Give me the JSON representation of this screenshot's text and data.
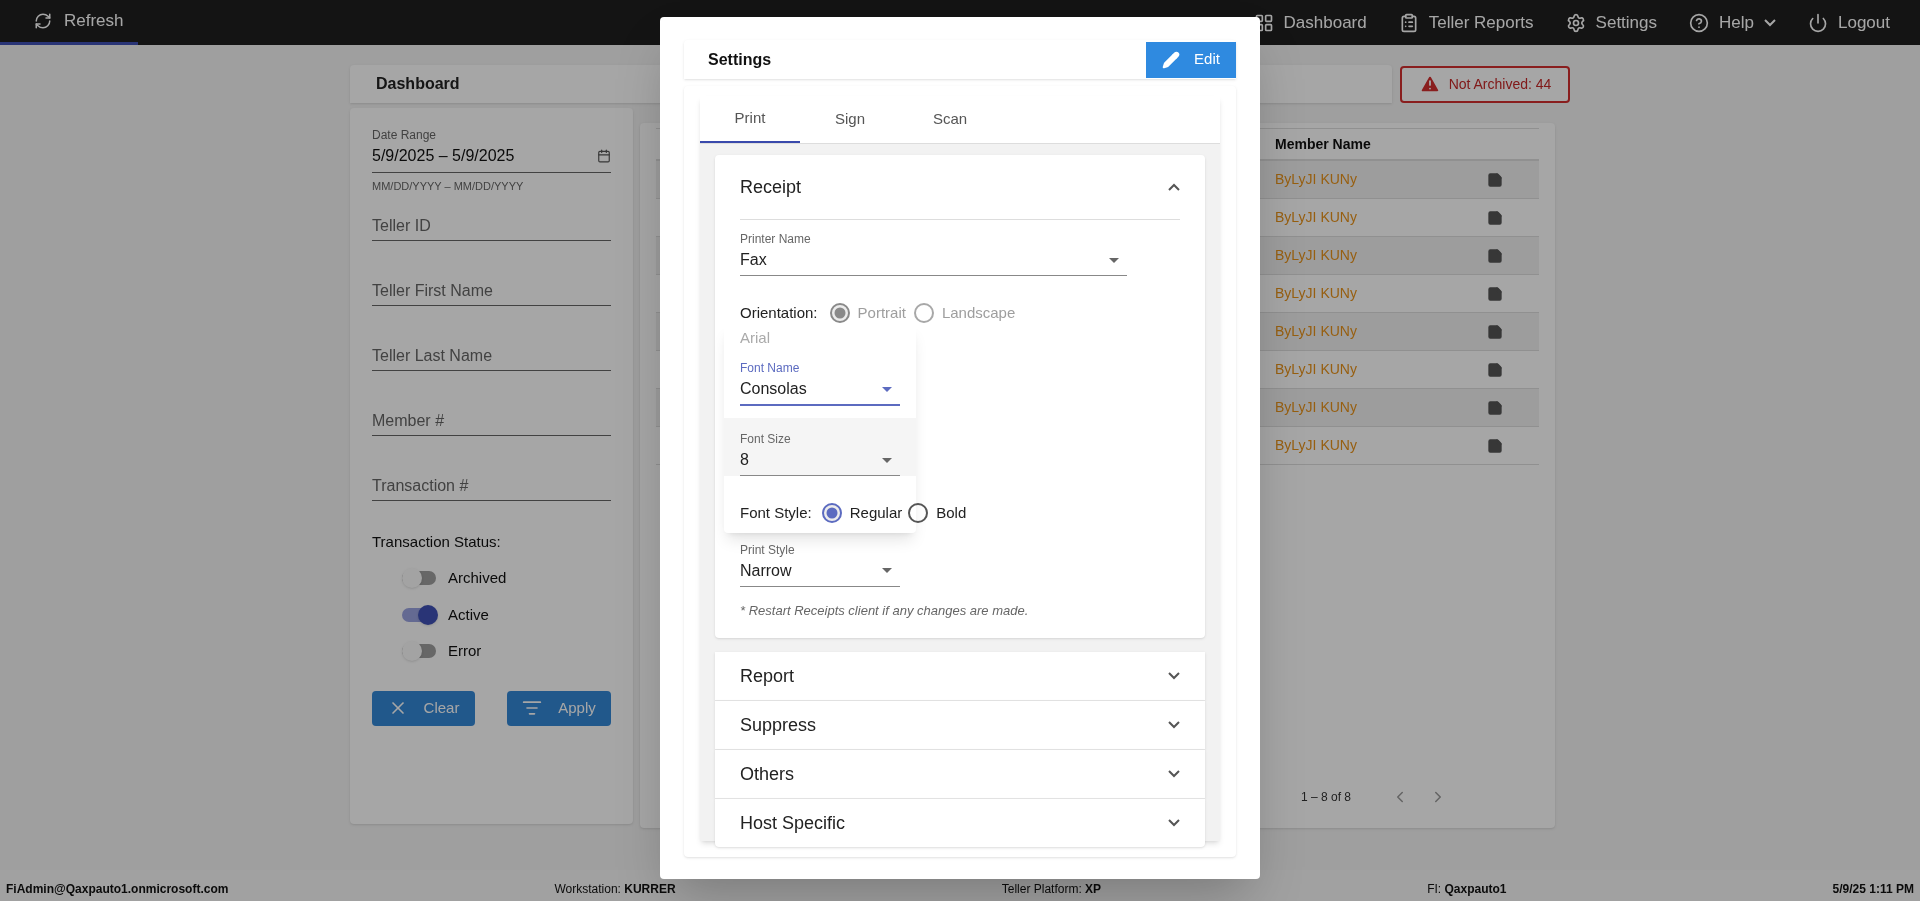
{
  "top_bar": {
    "refresh": "Refresh",
    "nav": [
      {
        "label": "Dashboard",
        "has_menu": false
      },
      {
        "label": "Teller Reports",
        "has_menu": false
      },
      {
        "label": "Settings",
        "has_menu": false
      },
      {
        "label": "Help",
        "has_menu": true
      },
      {
        "label": "Logout",
        "has_menu": false
      }
    ]
  },
  "dashboard": {
    "title": "Dashboard",
    "alert": "Not Archived: 44"
  },
  "filters": {
    "date_range": {
      "label": "Date Range",
      "value": "5/9/2025 – 5/9/2025",
      "hint": "MM/DD/YYYY – MM/DD/YYYY"
    },
    "fields": [
      {
        "placeholder": "Teller ID"
      },
      {
        "placeholder": "Teller First Name"
      },
      {
        "placeholder": "Teller Last Name"
      },
      {
        "placeholder": "Member #"
      },
      {
        "placeholder": "Transaction #"
      }
    ],
    "status_label": "Transaction Status:",
    "toggles": [
      {
        "label": "Archived",
        "on": false
      },
      {
        "label": "Active",
        "on": true
      },
      {
        "label": "Error",
        "on": false
      }
    ],
    "buttons": [
      "Clear",
      "Apply"
    ]
  },
  "table": {
    "columns": [
      "Member Name"
    ],
    "rows": [
      {
        "member_name": "ByLyJI KUNy"
      },
      {
        "member_name": "ByLyJI KUNy"
      },
      {
        "member_name": "ByLyJI KUNy"
      },
      {
        "member_name": "ByLyJI KUNy"
      },
      {
        "member_name": "ByLyJI KUNy"
      },
      {
        "member_name": "ByLyJI KUNy"
      },
      {
        "member_name": "ByLyJI KUNy"
      },
      {
        "member_name": "ByLyJI KUNy"
      }
    ],
    "pagination": "1 – 8 of 8"
  },
  "modal": {
    "title": "Settings",
    "edit": "Edit",
    "tabs": [
      {
        "label": "Print",
        "selected": true
      },
      {
        "label": "Sign",
        "selected": false
      },
      {
        "label": "Scan",
        "selected": false
      }
    ],
    "sections": [
      {
        "title": "Receipt",
        "expanded": true
      },
      {
        "title": "Report",
        "expanded": false
      },
      {
        "title": "Suppress",
        "expanded": false
      },
      {
        "title": "Others",
        "expanded": false
      },
      {
        "title": "Host Specific",
        "expanded": false
      }
    ],
    "receipt": {
      "printer": {
        "label": "Printer Name",
        "value": "Fax",
        "focused": false
      },
      "orientation": {
        "label": "Orientation:",
        "options": [
          {
            "label": "Portrait",
            "selected": true,
            "disabled": true
          },
          {
            "label": "Landscape",
            "selected": false,
            "disabled": true
          }
        ]
      },
      "font_menu": {
        "options": [
          {
            "label": "Arial"
          }
        ]
      },
      "font_name": {
        "label": "Font Name",
        "value": "Consolas",
        "focused": true
      },
      "font_size": {
        "label": "Font Size",
        "value": "8",
        "focused": false
      },
      "font_style": {
        "label": "Font Style:",
        "options": [
          {
            "label": "Regular",
            "selected": true,
            "disabled": false
          },
          {
            "label": "Bold",
            "selected": false,
            "disabled": false
          }
        ]
      },
      "print_style": {
        "label": "Print Style",
        "value": "Narrow",
        "focused": false
      },
      "note": "* Restart Receipts client if any changes are made."
    }
  },
  "status_bar": [
    "FiAdmin@Qaxpauto1.onmicrosoft.com",
    "Workstation: **KURRER**",
    "Teller Platform: **XP**",
    "FI: **Qaxpauto1**",
    "5/9/25 1:11 PM"
  ]
}
